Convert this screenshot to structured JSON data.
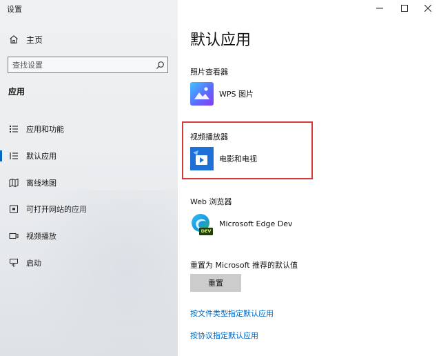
{
  "window": {
    "title": "设置",
    "controls": [
      "minimize",
      "maximize",
      "close"
    ]
  },
  "sidebar": {
    "home_label": "主页",
    "home_icon": "home-icon",
    "search_placeholder": "查找设置",
    "search_icon": "search-icon",
    "section_label": "应用",
    "items": [
      {
        "label": "应用和功能",
        "icon": "list-icon"
      },
      {
        "label": "默认应用",
        "icon": "default-list-icon",
        "active": true
      },
      {
        "label": "离线地图",
        "icon": "map-icon"
      },
      {
        "label": "可打开网站的应用",
        "icon": "web-app-icon"
      },
      {
        "label": "视频播放",
        "icon": "video-icon"
      },
      {
        "label": "启动",
        "icon": "startup-icon"
      }
    ],
    "accent": "#0067c0"
  },
  "main": {
    "title": "默认应用",
    "groups": [
      {
        "label": "照片查看器",
        "app_name": "WPS 图片",
        "app_icon": "wps-picture-icon"
      },
      {
        "label": "视频播放器",
        "app_name": "电影和电视",
        "app_icon": "movies-tv-icon"
      },
      {
        "label": "Web 浏览器",
        "app_name": "Microsoft Edge Dev",
        "app_icon": "edge-dev-icon",
        "badge": "DEV"
      }
    ],
    "reset": {
      "label": "重置为 Microsoft 推荐的默认值",
      "button": "重置"
    },
    "links": [
      "按文件类型指定默认应用",
      "按协议指定默认应用"
    ],
    "highlight_color": "#d33a3a"
  }
}
